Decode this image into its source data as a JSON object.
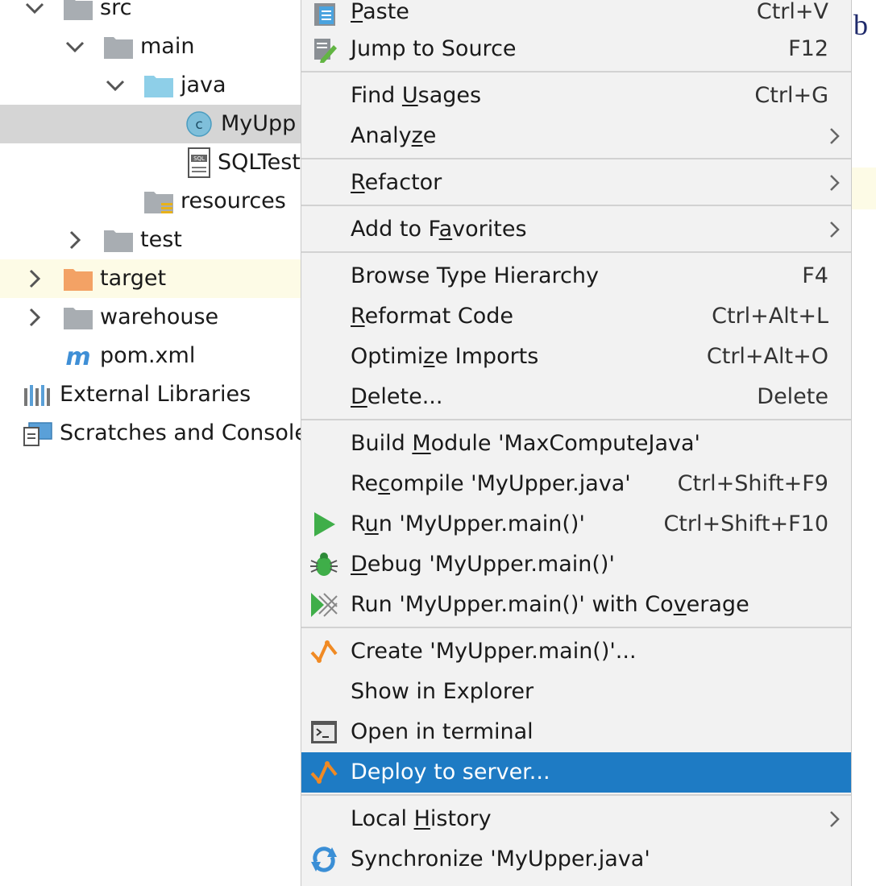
{
  "tree": [
    {
      "label": "src",
      "expanded": true,
      "icon": "folder-icon"
    },
    {
      "label": "main",
      "expanded": true,
      "icon": "folder-icon"
    },
    {
      "label": "java",
      "expanded": true,
      "icon": "source-folder-icon"
    },
    {
      "label": "MyUpp",
      "icon": "java-class-icon",
      "selected": true
    },
    {
      "label": "SQLTest",
      "icon": "sql-file-icon"
    },
    {
      "label": "resources",
      "icon": "resources-folder-icon"
    },
    {
      "label": "test",
      "expanded": false,
      "icon": "folder-icon"
    },
    {
      "label": "target",
      "expanded": false,
      "icon": "excluded-folder-icon",
      "highlighted": true
    },
    {
      "label": "warehouse",
      "expanded": false,
      "icon": "folder-icon"
    },
    {
      "label": "pom.xml",
      "icon": "maven-icon"
    },
    {
      "label": "External Libraries",
      "icon": "libraries-icon"
    },
    {
      "label": "Scratches and Console",
      "icon": "scratches-icon"
    }
  ],
  "editor": {
    "visible_char": "b"
  },
  "menu": [
    {
      "pre": "",
      "mn": "P",
      "post": "aste",
      "shortcut": "Ctrl+V",
      "icon": "paste-icon"
    },
    {
      "pre": "Jump to Source",
      "mn": "",
      "post": "",
      "shortcut": "F12",
      "icon": "edit-source-icon"
    },
    {
      "pre": "Find ",
      "mn": "U",
      "post": "sages",
      "shortcut": "Ctrl+G"
    },
    {
      "pre": "Analy",
      "mn": "z",
      "post": "e",
      "submenu": true
    },
    {
      "pre": "",
      "mn": "R",
      "post": "efactor",
      "submenu": true
    },
    {
      "pre": "Add to F",
      "mn": "a",
      "post": "vorites",
      "submenu": true
    },
    {
      "pre": "Browse Type Hierarchy",
      "mn": "",
      "post": "",
      "shortcut": "F4"
    },
    {
      "pre": "",
      "mn": "R",
      "post": "eformat Code",
      "shortcut": "Ctrl+Alt+L"
    },
    {
      "pre": "Optimi",
      "mn": "z",
      "post": "e Imports",
      "shortcut": "Ctrl+Alt+O"
    },
    {
      "pre": "",
      "mn": "D",
      "post": "elete...",
      "shortcut": "Delete"
    },
    {
      "pre": "Build ",
      "mn": "M",
      "post": "odule 'MaxComputeJava'"
    },
    {
      "pre": "Re",
      "mn": "c",
      "post": "ompile 'MyUpper.java'",
      "shortcut": "Ctrl+Shift+F9"
    },
    {
      "pre": "R",
      "mn": "u",
      "post": "n 'MyUpper.main()'",
      "shortcut": "Ctrl+Shift+F10",
      "icon": "run-icon"
    },
    {
      "pre": "",
      "mn": "D",
      "post": "ebug 'MyUpper.main()'",
      "icon": "debug-icon"
    },
    {
      "pre": "Run 'MyUpper.main()' with Co",
      "mn": "v",
      "post": "erage",
      "icon": "coverage-icon"
    },
    {
      "pre": "Create 'MyUpper.main()'...",
      "mn": "",
      "post": "",
      "icon": "deploy-icon"
    },
    {
      "pre": "Show in Explorer",
      "mn": "",
      "post": ""
    },
    {
      "pre": "Open in terminal",
      "mn": "",
      "post": "",
      "icon": "terminal-icon"
    },
    {
      "pre": "Deploy to server...",
      "mn": "",
      "post": "",
      "icon": "deploy-icon",
      "active": true
    },
    {
      "pre": "Local ",
      "mn": "H",
      "post": "istory",
      "submenu": true
    },
    {
      "pre": "Synchronize 'MyUpper.java'",
      "mn": "",
      "post": "",
      "icon": "sync-icon"
    }
  ],
  "colors": {
    "selection": "#1e7bc4",
    "tree_selection": "#d5d5d5",
    "menu_bg": "#f2f2f2",
    "highlight": "#fdfbe6"
  }
}
